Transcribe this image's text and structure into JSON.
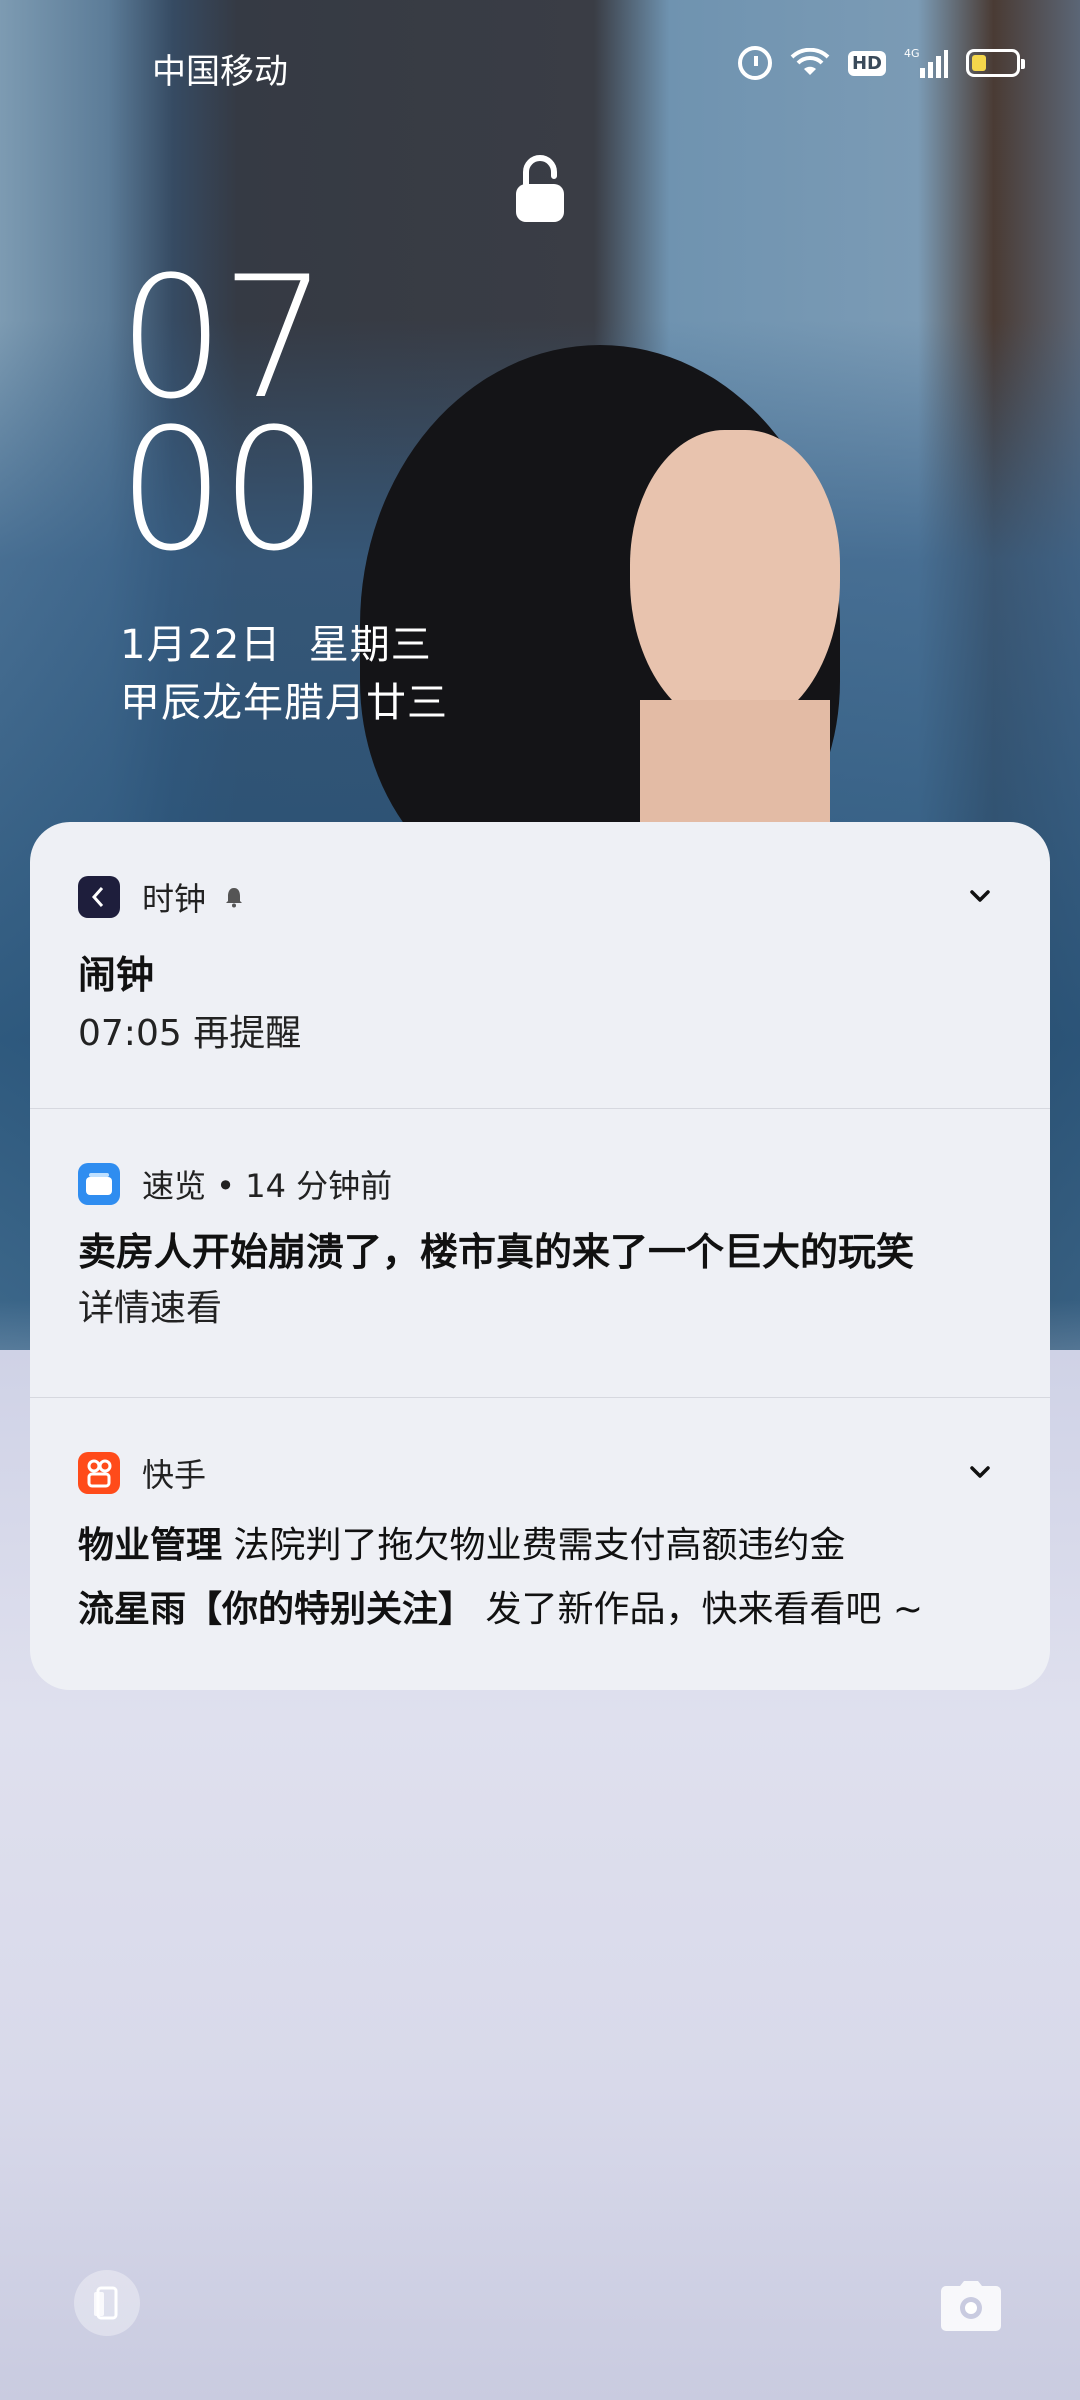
{
  "status_bar": {
    "carrier": "中国移动",
    "hd_badge": "HD",
    "network": "4G",
    "icons": [
      "alarm-icon",
      "wifi-icon",
      "hd-icon",
      "signal-icon",
      "battery-icon"
    ],
    "battery_level": 0.25
  },
  "lock": {
    "icon": "padlock-icon"
  },
  "clock": {
    "hour": "07",
    "minute": "00"
  },
  "date": {
    "gregorian": "1月22日  星期三",
    "lunar": "甲辰龙年腊月廿三"
  },
  "notifications": [
    {
      "app": "时钟",
      "icon": "clock-app-icon",
      "icon_color": "#1e1e3c",
      "show_bell": true,
      "expandable": true,
      "title": "闹钟",
      "body": "07:05 再提醒"
    },
    {
      "app": "速览 • 14 分钟前",
      "icon": "suilan-app-icon",
      "icon_color": "#2f8df0",
      "title": "卖房人开始崩溃了，楼市真的来了一个巨大的玩笑",
      "body": "详情速看"
    },
    {
      "app": "快手",
      "icon": "kuaishou-app-icon",
      "icon_color": "#ff4b1a",
      "expandable": true,
      "line1_bold": "物业管理",
      "line1_text": " 法院判了拖欠物业费需支付高额违约金",
      "line2_bold": "流星雨【你的特别关注】",
      "line2_text": " 发了新作品，快来看看吧 ~"
    }
  ],
  "shortcuts": {
    "left": "device-icon",
    "right": "camera-icon"
  }
}
